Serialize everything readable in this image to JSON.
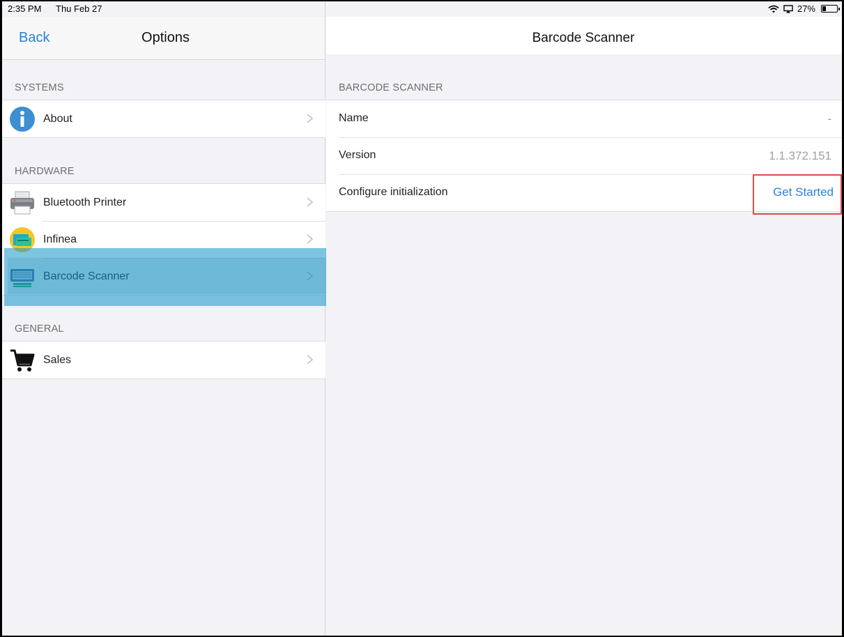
{
  "status_bar": {
    "time": "2:35 PM",
    "date": "Thu Feb 27",
    "battery_text": "27%",
    "battery_level": 0.27
  },
  "master": {
    "back_label": "Back",
    "title": "Options",
    "sections": [
      {
        "header": "SYSTEMS",
        "items": [
          {
            "label": "About",
            "icon": "info-icon"
          }
        ]
      },
      {
        "header": "HARDWARE",
        "items": [
          {
            "label": "Bluetooth Printer",
            "icon": "printer-icon"
          },
          {
            "label": "Infinea",
            "icon": "infinea-icon"
          },
          {
            "label": "Barcode Scanner",
            "icon": "barcode-scanner-icon",
            "selected": true
          }
        ]
      },
      {
        "header": "GENERAL",
        "items": [
          {
            "label": "Sales",
            "icon": "shopping-cart-icon"
          }
        ]
      }
    ]
  },
  "detail": {
    "title": "Barcode Scanner",
    "section_header": "BARCODE SCANNER",
    "rows": [
      {
        "label": "Name",
        "value": "-"
      },
      {
        "label": "Version",
        "value": "1.1.372.151"
      },
      {
        "label": "Configure initialization",
        "action": "Get Started"
      }
    ]
  },
  "colors": {
    "accent": "#2b7fd9",
    "highlight": "#1496c8",
    "annotation_box": "#e0484a"
  }
}
